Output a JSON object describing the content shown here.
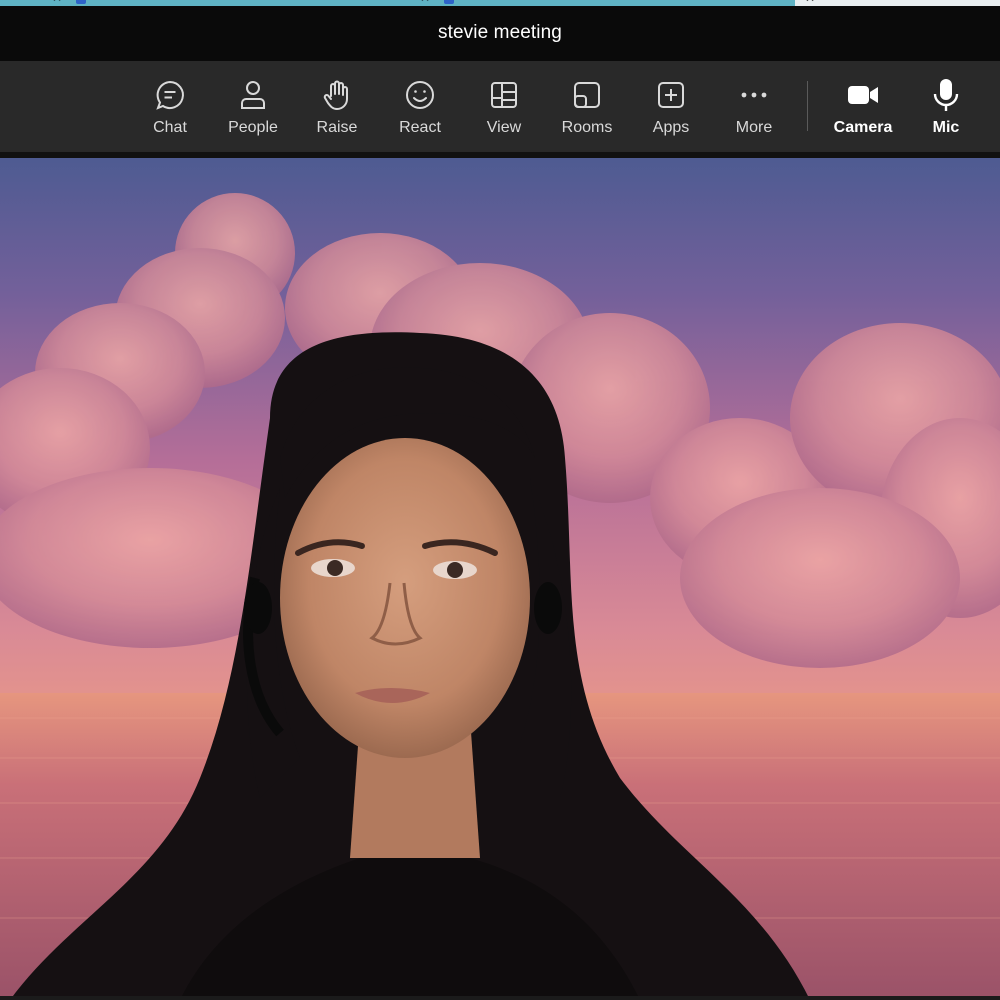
{
  "meeting": {
    "title": "stevie meeting"
  },
  "toolbar": {
    "items": [
      {
        "label": "Chat",
        "icon": "chat-icon"
      },
      {
        "label": "People",
        "icon": "person-icon"
      },
      {
        "label": "Raise",
        "icon": "hand-icon"
      },
      {
        "label": "React",
        "icon": "smiley-icon"
      },
      {
        "label": "View",
        "icon": "grid-icon"
      },
      {
        "label": "Rooms",
        "icon": "rooms-icon"
      },
      {
        "label": "Apps",
        "icon": "plus-square-icon"
      },
      {
        "label": "More",
        "icon": "ellipsis-icon"
      },
      {
        "label": "Camera",
        "icon": "camera-icon"
      },
      {
        "label": "Mic",
        "icon": "mic-icon"
      }
    ]
  },
  "colors": {
    "title_bar": "#0a0a0a",
    "toolbar": "#292929",
    "label": "#d9d9d9",
    "tab_strip": "#5fb3c4"
  }
}
